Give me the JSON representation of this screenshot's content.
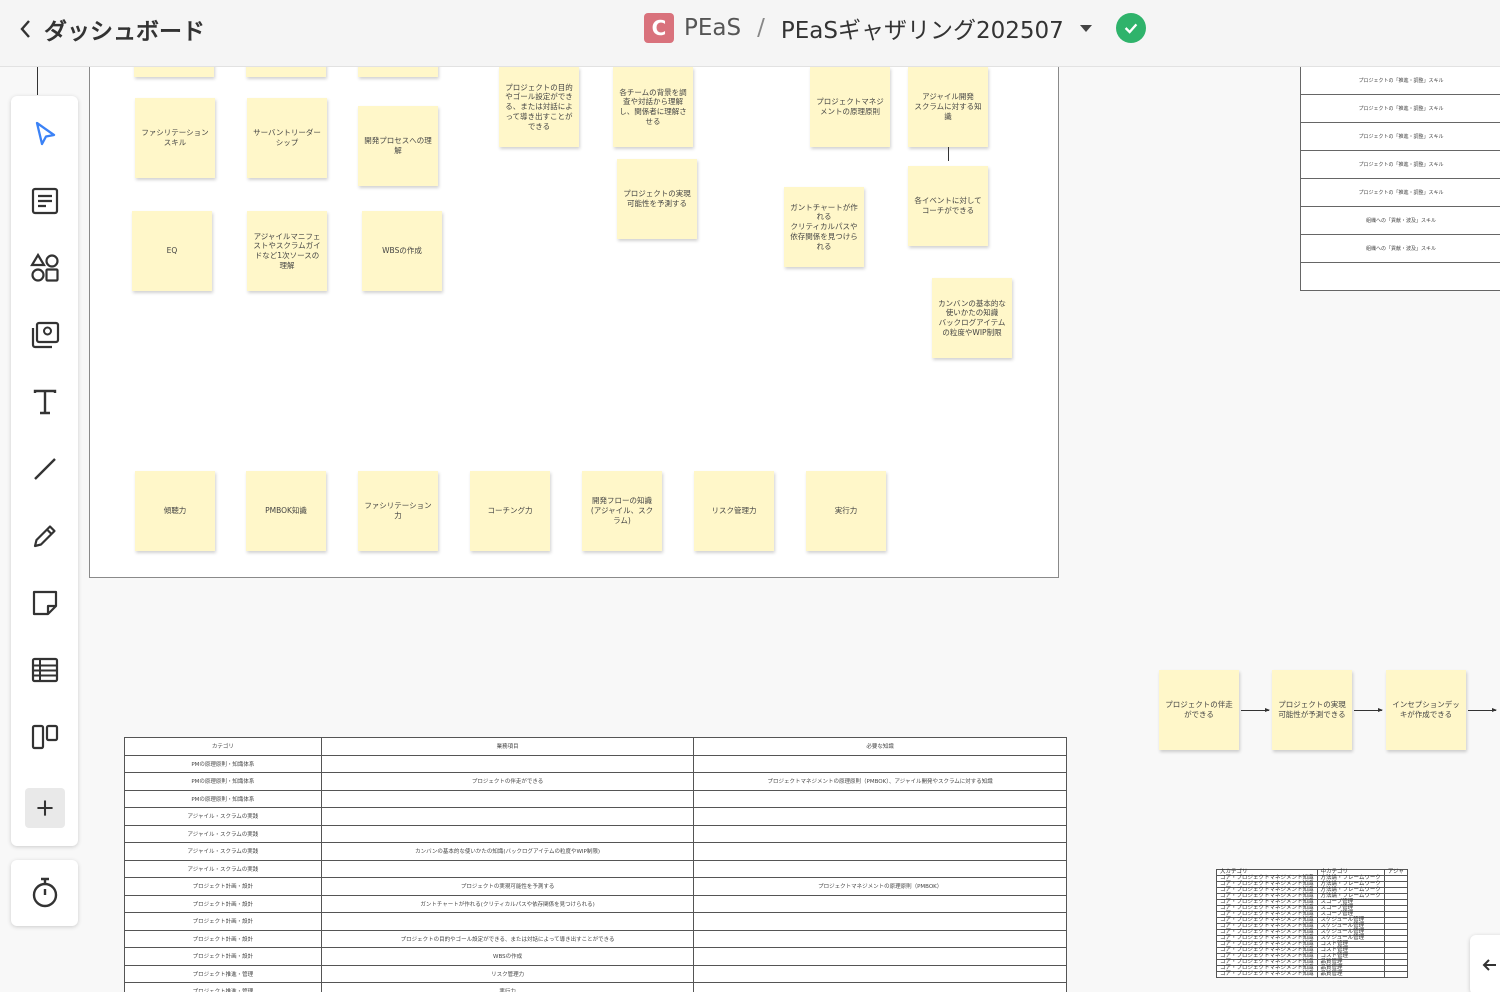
{
  "header": {
    "back_label": "ダッシュボード",
    "logo_letter": "C",
    "workspace": "PEaS",
    "separator": "/",
    "board_name": "PEaSギャザリング202507"
  },
  "frame_notes": {
    "col1_top": [
      "ファシリテーション\nスキル",
      "EQ"
    ],
    "col2_top": [
      "サーバントリーダー\nシップ",
      "アジャイルマニフェ\nストやスクラムガイ\nドなど1次ソースの\n理解"
    ],
    "col3_top": [
      "開発プロセスへの理\n解",
      "WBSの作成"
    ],
    "col4": [
      "プロジェクトの目的\nやゴール設定ができ\nる、または対話によ\nって導き出すことが\nできる"
    ],
    "col5": [
      "各チームの背景を調\n査や対話から理解\nし、関係者に理解さ\nせる",
      "プロジェクトの実現\n可能性を予測する"
    ],
    "col6": [
      "ガントチャートが作\nれる\nクリティカルパスや\n依存関係を見つけら\nれる"
    ],
    "col7": [
      "プロジェクトマネジ\nメントの原理原則"
    ],
    "col8": [
      "アジャイル開発\nスクラムに対する知\n識",
      "各イベントに対して\nコーチができる",
      "カンバンの基本的な\n使いかたの知識\nバックログアイテム\nの粒度やWIP制限"
    ],
    "bottom_row": [
      "傾聴力",
      "PMBOK知識",
      "ファシリテーション\n力",
      "コーチング力",
      "開発フローの知識\n(アジャイル、スク\nラム)",
      "リスク管理力",
      "実行力"
    ]
  },
  "right_table": [
    "プロジェクトの「推進・調整」スキル",
    "プロジェクトの「推進・調整」スキル",
    "プロジェクトの「推進・調整」スキル",
    "プロジェクトの「推進・調整」スキル",
    "プロジェクトの「推進・調整」スキル",
    "組織への「貢献・波及」スキル",
    "組織への「貢献・波及」スキル",
    ""
  ],
  "flow_notes": [
    "プロジェクトの伴走\nができる",
    "プロジェクトの実現\n可能性が予測できる",
    "インセプションデッ\nキが作成できる"
  ],
  "big_table": {
    "headers": [
      "カテゴリ",
      "業務項目",
      "必要な知識"
    ],
    "rows": [
      [
        "PMの原理原則・知識体系",
        "",
        ""
      ],
      [
        "PMの原理原則・知識体系",
        "プロジェクトの伴走ができる",
        "プロジェクトマネジメントの原理原則（PMBOK）、アジャイル開発やスクラムに対する知識"
      ],
      [
        "PMの原理原則・知識体系",
        "",
        ""
      ],
      [
        "アジャイル・スクラムの実践",
        "",
        ""
      ],
      [
        "アジャイル・スクラムの実践",
        "",
        ""
      ],
      [
        "アジャイル・スクラムの実践",
        "カンバンの基本的な使いかたの知識(バックログアイテムの粒度やWIP制限)",
        ""
      ],
      [
        "アジャイル・スクラムの実践",
        "",
        ""
      ],
      [
        "プロジェクト計画・設計",
        "プロジェクトの実現可能性を予測する",
        "プロジェクトマネジメントの原理原則（PMBOK）"
      ],
      [
        "プロジェクト計画・設計",
        "ガントチャートが作れる(クリティカルパスや依存関係を見つけられる)",
        ""
      ],
      [
        "プロジェクト計画・設計",
        "",
        ""
      ],
      [
        "プロジェクト計画・設計",
        "プロジェクトの目的やゴール設定ができる、または対話によって導き出すことができる",
        ""
      ],
      [
        "プロジェクト計画・設計",
        "WBSの作成",
        ""
      ],
      [
        "プロジェクト推進・管理",
        "リスク管理力",
        ""
      ],
      [
        "プロジェクト推進・管理",
        "実行力",
        ""
      ]
    ]
  },
  "mini_table": {
    "headers": [
      "大カテゴリ",
      "中カテゴリ",
      "アジャ"
    ],
    "rows": [
      [
        "コア・プロジェクトマネジメント知識",
        "方法論・フレームワーク"
      ],
      [
        "コア・プロジェクトマネジメント知識",
        "方法論・フレームワーク"
      ],
      [
        "コア・プロジェクトマネジメント知識",
        "方法論・フレームワーク"
      ],
      [
        "コア・プロジェクトマネジメント知識",
        "方法論・フレームワーク"
      ],
      [
        "コア・プロジェクトマネジメント知識",
        "スコープ管理"
      ],
      [
        "コア・プロジェクトマネジメント知識",
        "スコープ管理"
      ],
      [
        "コア・プロジェクトマネジメント知識",
        "スコープ管理"
      ],
      [
        "コア・プロジェクトマネジメント知識",
        "スケジュール管理"
      ],
      [
        "コア・プロジェクトマネジメント知識",
        "スケジュール管理"
      ],
      [
        "コア・プロジェクトマネジメント知識",
        "スケジュール管理"
      ],
      [
        "コア・プロジェクトマネジメント知識",
        "スケジュール管理"
      ],
      [
        "コア・プロジェクトマネジメント知識",
        "コスト管理"
      ],
      [
        "コア・プロジェクトマネジメント知識",
        "コスト管理"
      ],
      [
        "コア・プロジェクトマネジメント知識",
        "コスト管理"
      ],
      [
        "コア・プロジェクトマネジメント知識",
        "品質管理"
      ],
      [
        "コア・プロジェクトマネジメント知識",
        "品質管理"
      ],
      [
        "コア・プロジェクトマネジメント知識",
        "品質管理"
      ]
    ]
  },
  "colors": {
    "accent": "#2fb36b",
    "logo": "#d9727c",
    "note": "#fff7c9"
  }
}
